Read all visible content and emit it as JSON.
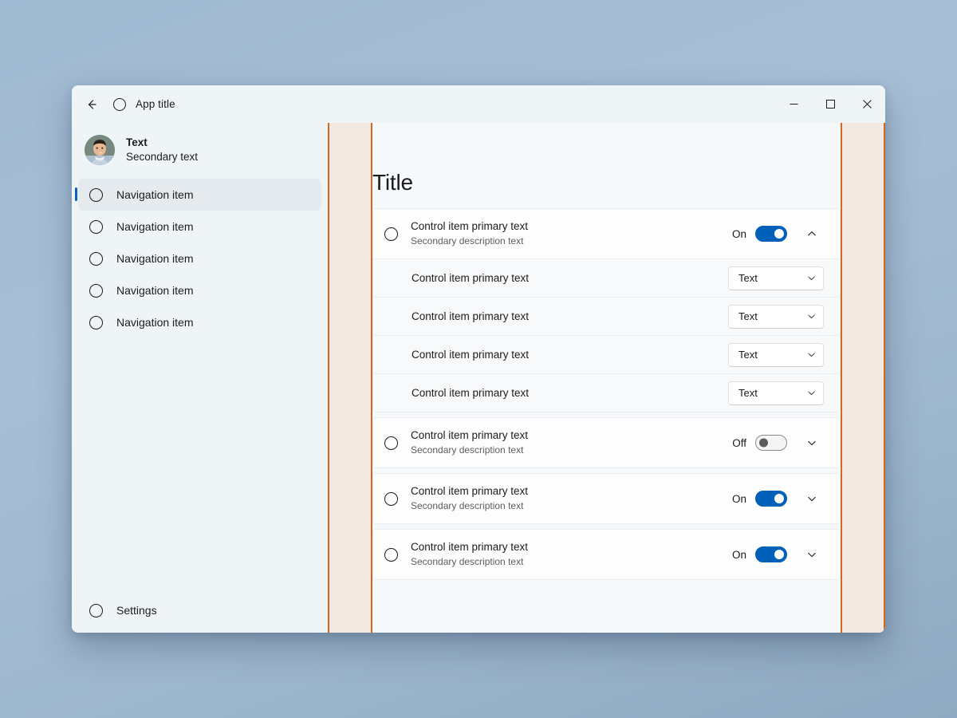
{
  "window": {
    "titlebar": {
      "back_icon": "back-arrow-icon",
      "app_icon": "app-circle-icon",
      "title": "App title",
      "minimize_label": "–",
      "maximize_label": "☐",
      "close_label": "✕"
    }
  },
  "sidebar": {
    "account": {
      "avatar_icon": "user-avatar-photo",
      "primary": "Text",
      "secondary": "Secondary text"
    },
    "items": [
      {
        "label": "Navigation item",
        "icon": "circle-icon",
        "selected": true
      },
      {
        "label": "Navigation item",
        "icon": "circle-icon",
        "selected": false
      },
      {
        "label": "Navigation item",
        "icon": "circle-icon",
        "selected": false
      },
      {
        "label": "Navigation item",
        "icon": "circle-icon",
        "selected": false
      },
      {
        "label": "Navigation item",
        "icon": "circle-icon",
        "selected": false
      }
    ],
    "settings": {
      "label": "Settings",
      "icon": "circle-icon"
    }
  },
  "main": {
    "title": "Title",
    "groups": [
      {
        "icon": "circle-icon",
        "primary": "Control item primary text",
        "secondary": "Secondary description text",
        "toggle_state": "On",
        "toggle_on": true,
        "expanded": true,
        "expand_icon": "chevron-up-icon",
        "subitems": [
          {
            "label": "Control item primary text",
            "combo_value": "Text",
            "combo_icon": "chevron-down-icon"
          },
          {
            "label": "Control item primary text",
            "combo_value": "Text",
            "combo_icon": "chevron-down-icon"
          },
          {
            "label": "Control item primary text",
            "combo_value": "Text",
            "combo_icon": "chevron-down-icon"
          },
          {
            "label": "Control item primary text",
            "combo_value": "Text",
            "combo_icon": "chevron-down-icon"
          }
        ]
      },
      {
        "icon": "circle-icon",
        "primary": "Control item primary text",
        "secondary": "Secondary description text",
        "toggle_state": "Off",
        "toggle_on": false,
        "expanded": false,
        "expand_icon": "chevron-down-icon",
        "subitems": []
      },
      {
        "icon": "circle-icon",
        "primary": "Control item primary text",
        "secondary": "Secondary description text",
        "toggle_state": "On",
        "toggle_on": true,
        "expanded": false,
        "expand_icon": "chevron-down-icon",
        "subitems": []
      },
      {
        "icon": "circle-icon",
        "primary": "Control item primary text",
        "secondary": "Secondary description text",
        "toggle_state": "On",
        "toggle_on": true,
        "expanded": false,
        "expand_icon": "chevron-down-icon",
        "subitems": []
      }
    ]
  },
  "annotations": {
    "left_band": "spacing-measure-band-left",
    "right_band": "spacing-measure-band-right",
    "band_color": "#f3e8e2",
    "band_border_color": "#d2691e"
  },
  "colors": {
    "accent": "#0060ba",
    "selection_bar": "#0f5ec0",
    "sidebar_bg": "#eff5f7",
    "content_bg": "#f6f9fb",
    "card_bg": "#fdfdfe",
    "desktop_bg": "#9fb9d2"
  }
}
